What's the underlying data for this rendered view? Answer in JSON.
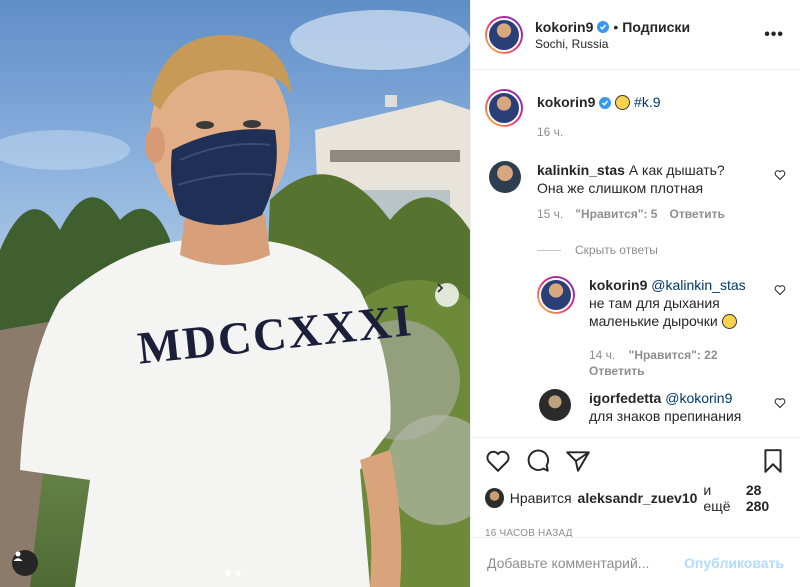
{
  "post": {
    "username": "kokorin9",
    "follow_label": "Подписки",
    "location": "Sochi, Russia",
    "caption": "#k.9",
    "caption_time": "16 ч.",
    "shirt_text": "MDCCXXXI"
  },
  "comments": [
    {
      "username": "kalinkin_stas",
      "text": "А как дышать? Она же слишком плотная",
      "time": "15 ч.",
      "likes": "\"Нравится\": 5",
      "reply_label": "Ответить"
    },
    {
      "username": "kokorin9",
      "mention": "@kalinkin_stas",
      "text": "не там для дыхания маленькие дырочки",
      "time": "14 ч.",
      "likes": "\"Нравится\": 22",
      "reply_label": "Ответить"
    },
    {
      "username": "igorfedetta",
      "mention": "@kokorin9",
      "text": "для знаков препинания"
    }
  ],
  "hide_replies_label": "Скрыть ответы",
  "likes_line": {
    "prefix": "Нравится",
    "user": "aleksandr_zuev10",
    "suffix": "и ещё",
    "count": "28 280"
  },
  "timestamp": "16 ЧАСОВ НАЗАД",
  "comment_input": {
    "placeholder": "Добавьте комментарий...",
    "publish_label": "Опубликовать"
  },
  "colors": {
    "verified": "#3897f0",
    "publish": "#b3dbff"
  }
}
